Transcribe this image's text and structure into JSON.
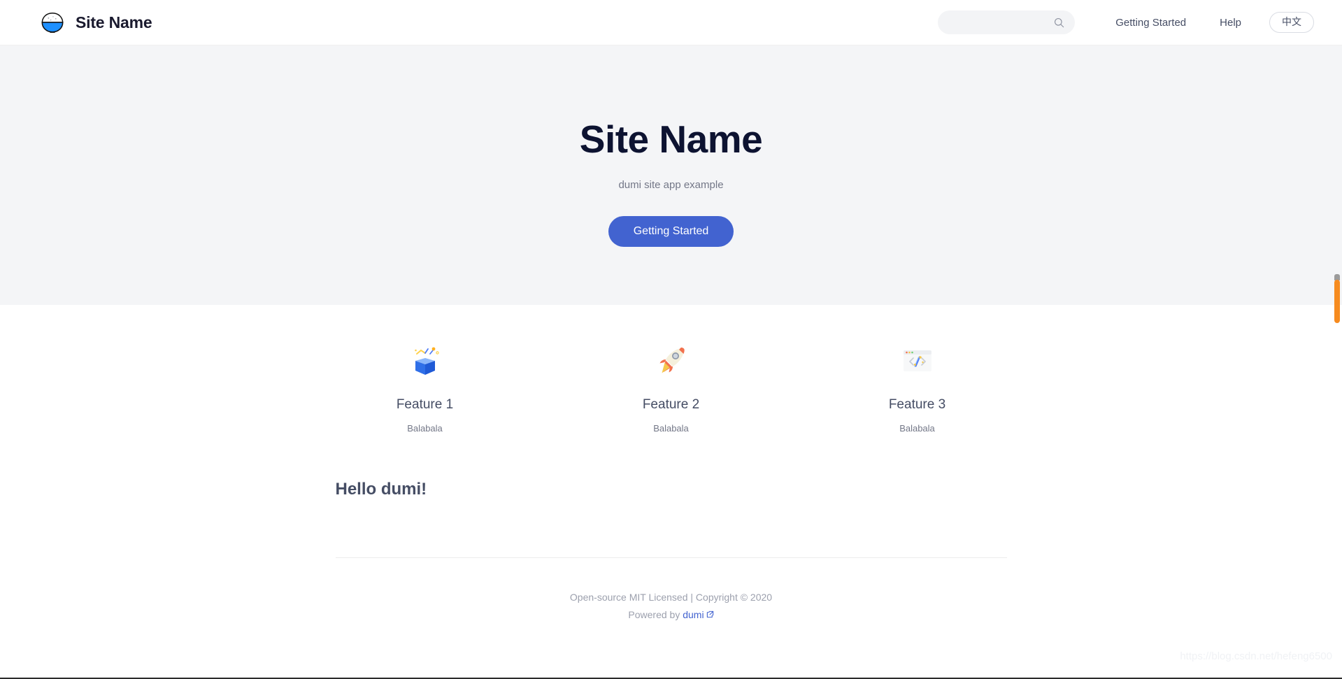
{
  "navbar": {
    "logo_icon": "rice-bowl-logo-icon",
    "brand_title": "Site Name",
    "search": {
      "icon": "search-icon",
      "value": "",
      "placeholder": ""
    },
    "links": [
      {
        "label": "Getting Started"
      },
      {
        "label": "Help"
      }
    ],
    "lang_switch_label": "中文"
  },
  "hero": {
    "title": "Site Name",
    "description": "dumi site app example",
    "cta_label": "Getting Started",
    "background_color": "#f4f5f7",
    "cta_color": "#4263d0",
    "title_color": "#0d1331"
  },
  "features": [
    {
      "icon": "open-gift-box-icon",
      "title": "Feature 1",
      "description": "Balabala"
    },
    {
      "icon": "rocket-icon",
      "title": "Feature 2",
      "description": "Balabala"
    },
    {
      "icon": "code-window-icon",
      "title": "Feature 3",
      "description": "Balabala"
    }
  ],
  "article": {
    "heading": "Hello dumi!"
  },
  "footer": {
    "license_text": "Open-source MIT Licensed | Copyright © 2020",
    "powered_by_prefix": "Powered by ",
    "powered_by_link": "dumi",
    "external_link_icon": "external-link-icon",
    "link_color": "#4263d0"
  },
  "watermark": {
    "text": "https://blog.csdn.net/hefeng6500"
  },
  "scrollbar": {
    "thumb_color": "#f68b1f"
  }
}
